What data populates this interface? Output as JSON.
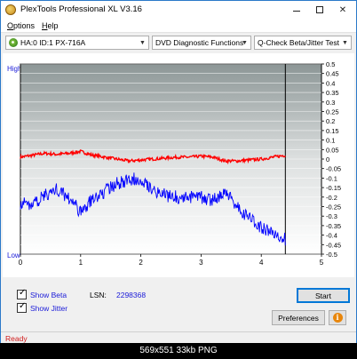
{
  "window": {
    "title": "PlexTools Professional XL V3.16"
  },
  "menu": {
    "options_first": "O",
    "options_rest": "ptions",
    "help_first": "H",
    "help_rest": "elp"
  },
  "toolbar": {
    "drive": "HA:0 ID:1  PX-716A",
    "function": "DVD Diagnostic Functions",
    "test": "Q-Check Beta/Jitter Test"
  },
  "chart_data": {
    "type": "line",
    "x_ticks": [
      "0",
      "1",
      "2",
      "3",
      "4",
      "5"
    ],
    "xlim": [
      0,
      5
    ],
    "y_left_labels": {
      "high": "High",
      "low": "Low"
    },
    "y_right_ticks": [
      "0.5",
      "0.45",
      "0.4",
      "0.35",
      "0.3",
      "0.25",
      "0.2",
      "0.15",
      "0.1",
      "0.05",
      "0",
      "-0.05",
      "-0.1",
      "-0.15",
      "-0.2",
      "-0.25",
      "-0.3",
      "-0.35",
      "-0.4",
      "-0.45",
      "-0.5"
    ],
    "ylim": [
      -0.5,
      0.5
    ],
    "end_marker_x": 4.4,
    "grid": true,
    "series": [
      {
        "name": "Beta",
        "color": "#ff0000",
        "x": [
          0,
          0.2,
          0.4,
          0.6,
          0.8,
          1.0,
          1.2,
          1.4,
          1.6,
          1.8,
          2.0,
          2.2,
          2.4,
          2.6,
          2.8,
          3.0,
          3.2,
          3.4,
          3.6,
          3.8,
          4.0,
          4.2,
          4.4
        ],
        "values": [
          0.01,
          0.02,
          0.03,
          0.025,
          0.03,
          0.04,
          0.02,
          0.01,
          0.0,
          -0.01,
          -0.005,
          0.0,
          0.005,
          0.01,
          0.01,
          0.015,
          0.01,
          -0.01,
          -0.01,
          -0.005,
          0.0,
          0.01,
          0.02
        ]
      },
      {
        "name": "Jitter",
        "color": "#0000ff",
        "x": [
          0,
          0.2,
          0.4,
          0.6,
          0.8,
          1.0,
          1.2,
          1.4,
          1.6,
          1.8,
          2.0,
          2.2,
          2.4,
          2.6,
          2.8,
          3.0,
          3.2,
          3.4,
          3.6,
          3.8,
          4.0,
          4.2,
          4.4
        ],
        "values": [
          -0.23,
          -0.24,
          -0.19,
          -0.16,
          -0.2,
          -0.28,
          -0.21,
          -0.17,
          -0.13,
          -0.11,
          -0.1,
          -0.16,
          -0.19,
          -0.2,
          -0.2,
          -0.2,
          -0.22,
          -0.17,
          -0.25,
          -0.31,
          -0.36,
          -0.39,
          -0.42
        ]
      }
    ]
  },
  "controls": {
    "show_beta": "Show Beta",
    "show_jitter": "Show Jitter",
    "lsn_label": "LSN:",
    "lsn_value": "2298368",
    "start": "Start",
    "preferences": "Preferences"
  },
  "status": {
    "text": "Ready"
  },
  "caption": "569x551 33kb PNG"
}
